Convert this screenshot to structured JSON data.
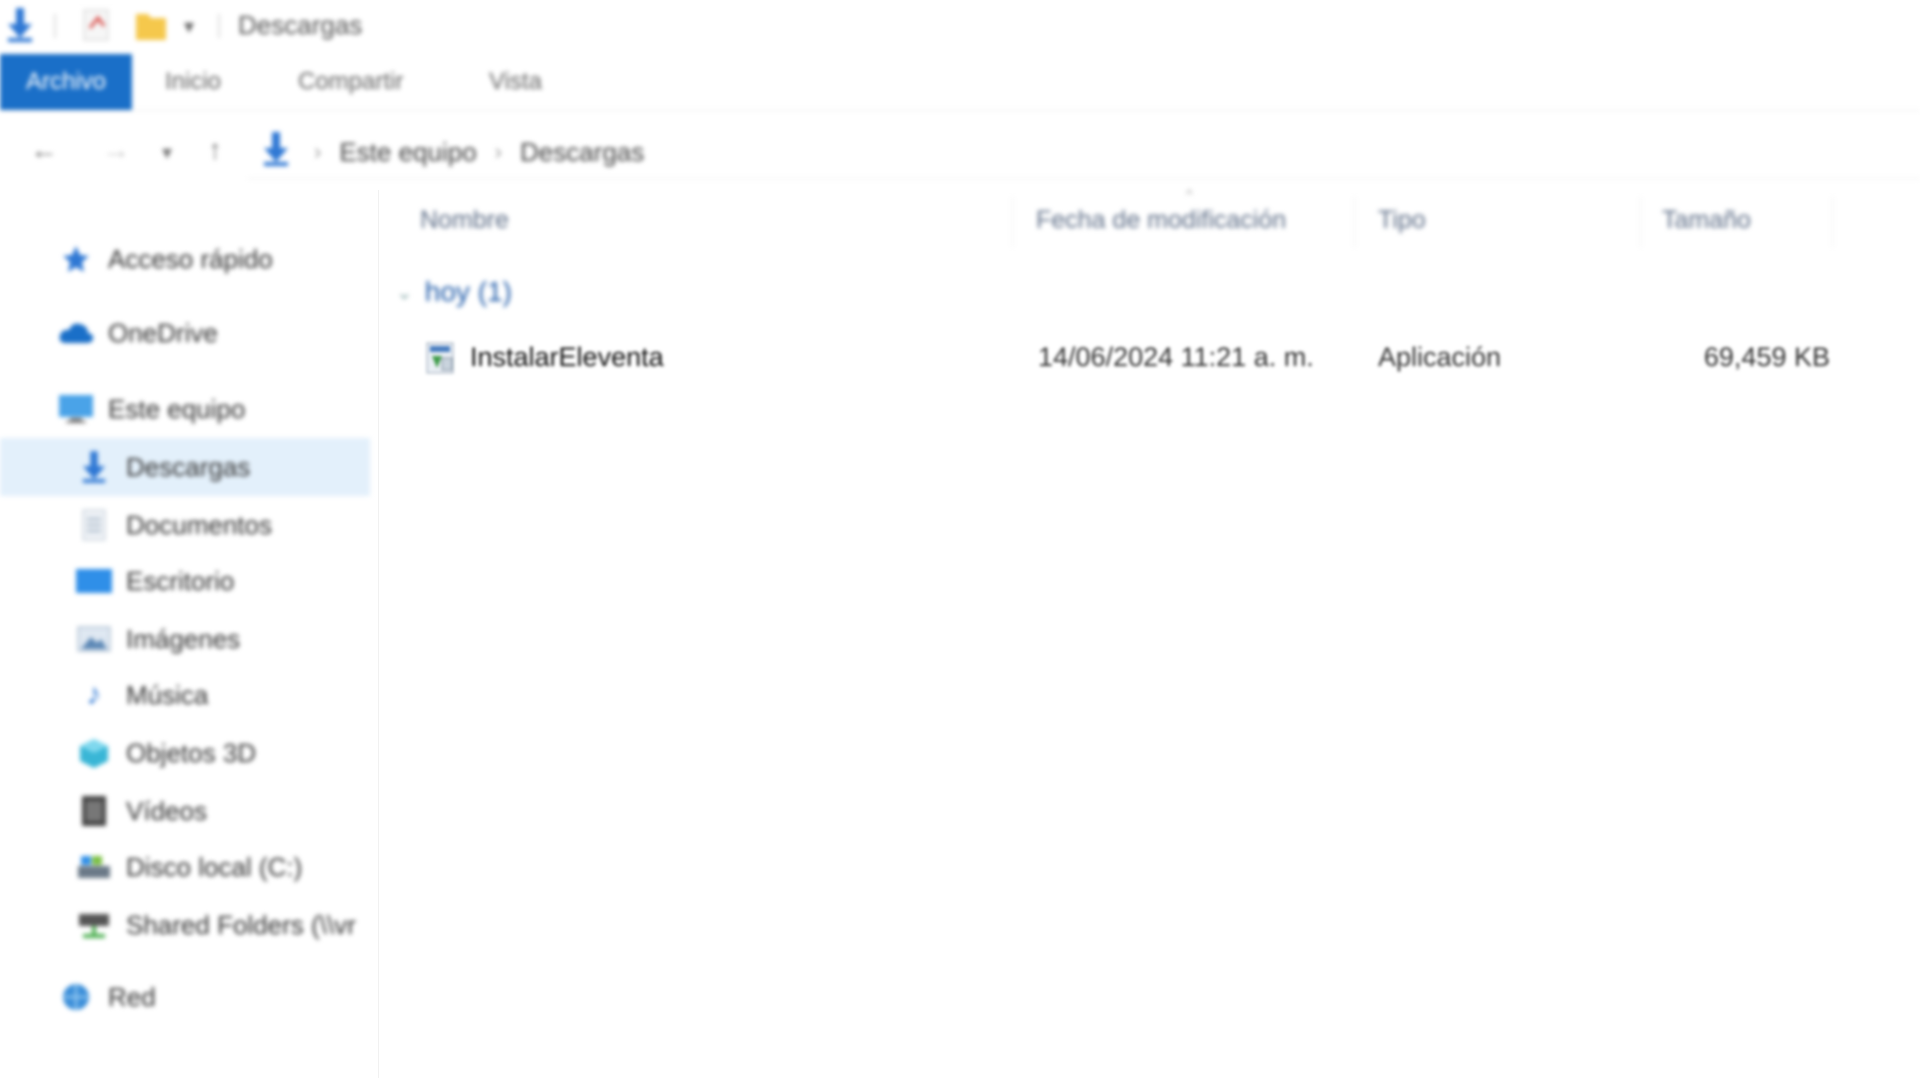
{
  "window": {
    "title": "Descargas"
  },
  "ribbon": {
    "tabs": [
      "Archivo",
      "Inicio",
      "Compartir",
      "Vista"
    ]
  },
  "address": {
    "crumbs": [
      "Este equipo",
      "Descargas"
    ]
  },
  "sidebar": {
    "items": [
      {
        "label": "Acceso rápido",
        "icon": "star-icon"
      },
      {
        "label": "OneDrive",
        "icon": "cloud-icon"
      },
      {
        "label": "Este equipo",
        "icon": "computer-icon"
      },
      {
        "label": "Descargas",
        "icon": "download-icon",
        "selected": true
      },
      {
        "label": "Documentos",
        "icon": "document-icon"
      },
      {
        "label": "Escritorio",
        "icon": "desktop-icon"
      },
      {
        "label": "Imágenes",
        "icon": "pictures-icon"
      },
      {
        "label": "Música",
        "icon": "music-icon"
      },
      {
        "label": "Objetos 3D",
        "icon": "objects3d-icon"
      },
      {
        "label": "Vídeos",
        "icon": "video-icon"
      },
      {
        "label": "Disco local (C:)",
        "icon": "drive-icon"
      },
      {
        "label": "Shared Folders (\\\\vr",
        "icon": "network-drive-icon"
      },
      {
        "label": "Red",
        "icon": "network-icon"
      }
    ]
  },
  "columns": {
    "name": "Nombre",
    "date": "Fecha de modificación",
    "type": "Tipo",
    "size": "Tamaño"
  },
  "group": {
    "label": "hoy (1)"
  },
  "files": [
    {
      "name": "InstalarEleventa",
      "date": "14/06/2024 11:21 a. m.",
      "type": "Aplicación",
      "size": "69,459 KB",
      "icon": "installer-icon"
    }
  ],
  "colors": {
    "accent": "#1a6fc8",
    "selection": "#cce4f7",
    "header_text": "#5f6f88"
  }
}
